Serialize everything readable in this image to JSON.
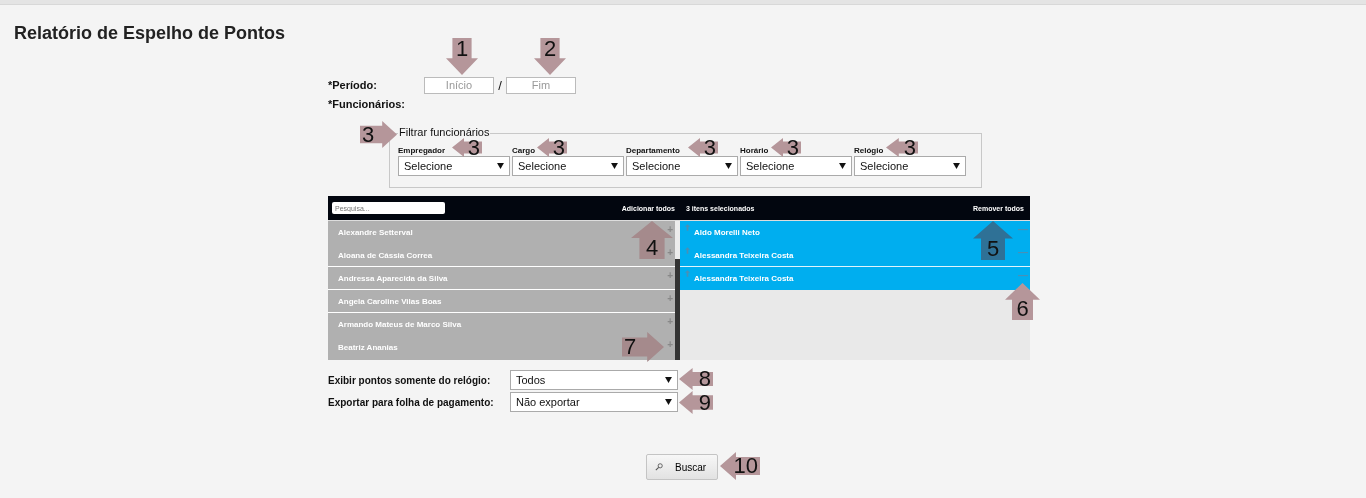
{
  "page": {
    "title": "Relatório de Espelho de Pontos"
  },
  "period": {
    "label": "*Período:",
    "start_placeholder": "Início",
    "separator": "/",
    "end_placeholder": "Fim"
  },
  "employees_label": "*Funcionários:",
  "filter": {
    "legend": "Filtrar funcionários",
    "fields": [
      {
        "label": "Empregador",
        "value": "Selecione"
      },
      {
        "label": "Cargo",
        "value": "Selecione"
      },
      {
        "label": "Departamento",
        "value": "Selecione"
      },
      {
        "label": "Horário",
        "value": "Selecione"
      },
      {
        "label": "Relógio",
        "value": "Selecione"
      }
    ]
  },
  "picker": {
    "search_placeholder": "Pesquisa...",
    "add_all": "Adicionar todos",
    "selected_count": "3 itens selecionados",
    "remove_all": "Remover todos",
    "available": [
      {
        "name": "Alexandre Setterval",
        "action": "+",
        "divider_below": false
      },
      {
        "name": "Aloana de Cássia Correa",
        "action": "+",
        "divider_below": true
      },
      {
        "name": "Andressa Aparecida da Silva",
        "action": "+",
        "divider_below": true
      },
      {
        "name": "Angela Caroline Vilas Boas",
        "action": "+",
        "divider_below": true
      },
      {
        "name": "Armando Mateus de Marco Silva",
        "action": "+",
        "divider_below": false
      },
      {
        "name": "Beatriz Ananias",
        "action": "+",
        "divider_below": false
      }
    ],
    "selected": [
      {
        "name": "Aldo Morelli Neto",
        "action": "—",
        "divider_below": false
      },
      {
        "name": "Alessandra Teixeira Costa",
        "action": "—",
        "divider_below": true
      },
      {
        "name": "Alessandra Teixeira Costa",
        "action": "—",
        "divider_below": false
      }
    ]
  },
  "options": [
    {
      "label": "Exibir pontos somente do relógio:",
      "value": "Todos"
    },
    {
      "label": "Exportar para folha de pagamento:",
      "value": "Não exportar"
    }
  ],
  "search_button": {
    "label": "Buscar"
  },
  "callouts": [
    {
      "label": "1",
      "color": "#b5969a"
    },
    {
      "label": "2",
      "color": "#b5969a"
    },
    {
      "label": "3",
      "color": "#b5969a"
    },
    {
      "label": "3",
      "color": "#b5969a"
    },
    {
      "label": "3",
      "color": "#b5969a"
    },
    {
      "label": "3",
      "color": "#b5969a"
    },
    {
      "label": "3",
      "color": "#b5969a"
    },
    {
      "label": "3",
      "color": "#b5969a"
    },
    {
      "label": "4",
      "color": "#a58a8c"
    },
    {
      "label": "5",
      "color": "#2f7196"
    },
    {
      "label": "6",
      "color": "#b5969a"
    },
    {
      "label": "7",
      "color": "#a58a8c"
    },
    {
      "label": "8",
      "color": "#b5969a"
    },
    {
      "label": "9",
      "color": "#b5969a"
    },
    {
      "label": "10",
      "color": "#b5969a"
    }
  ]
}
